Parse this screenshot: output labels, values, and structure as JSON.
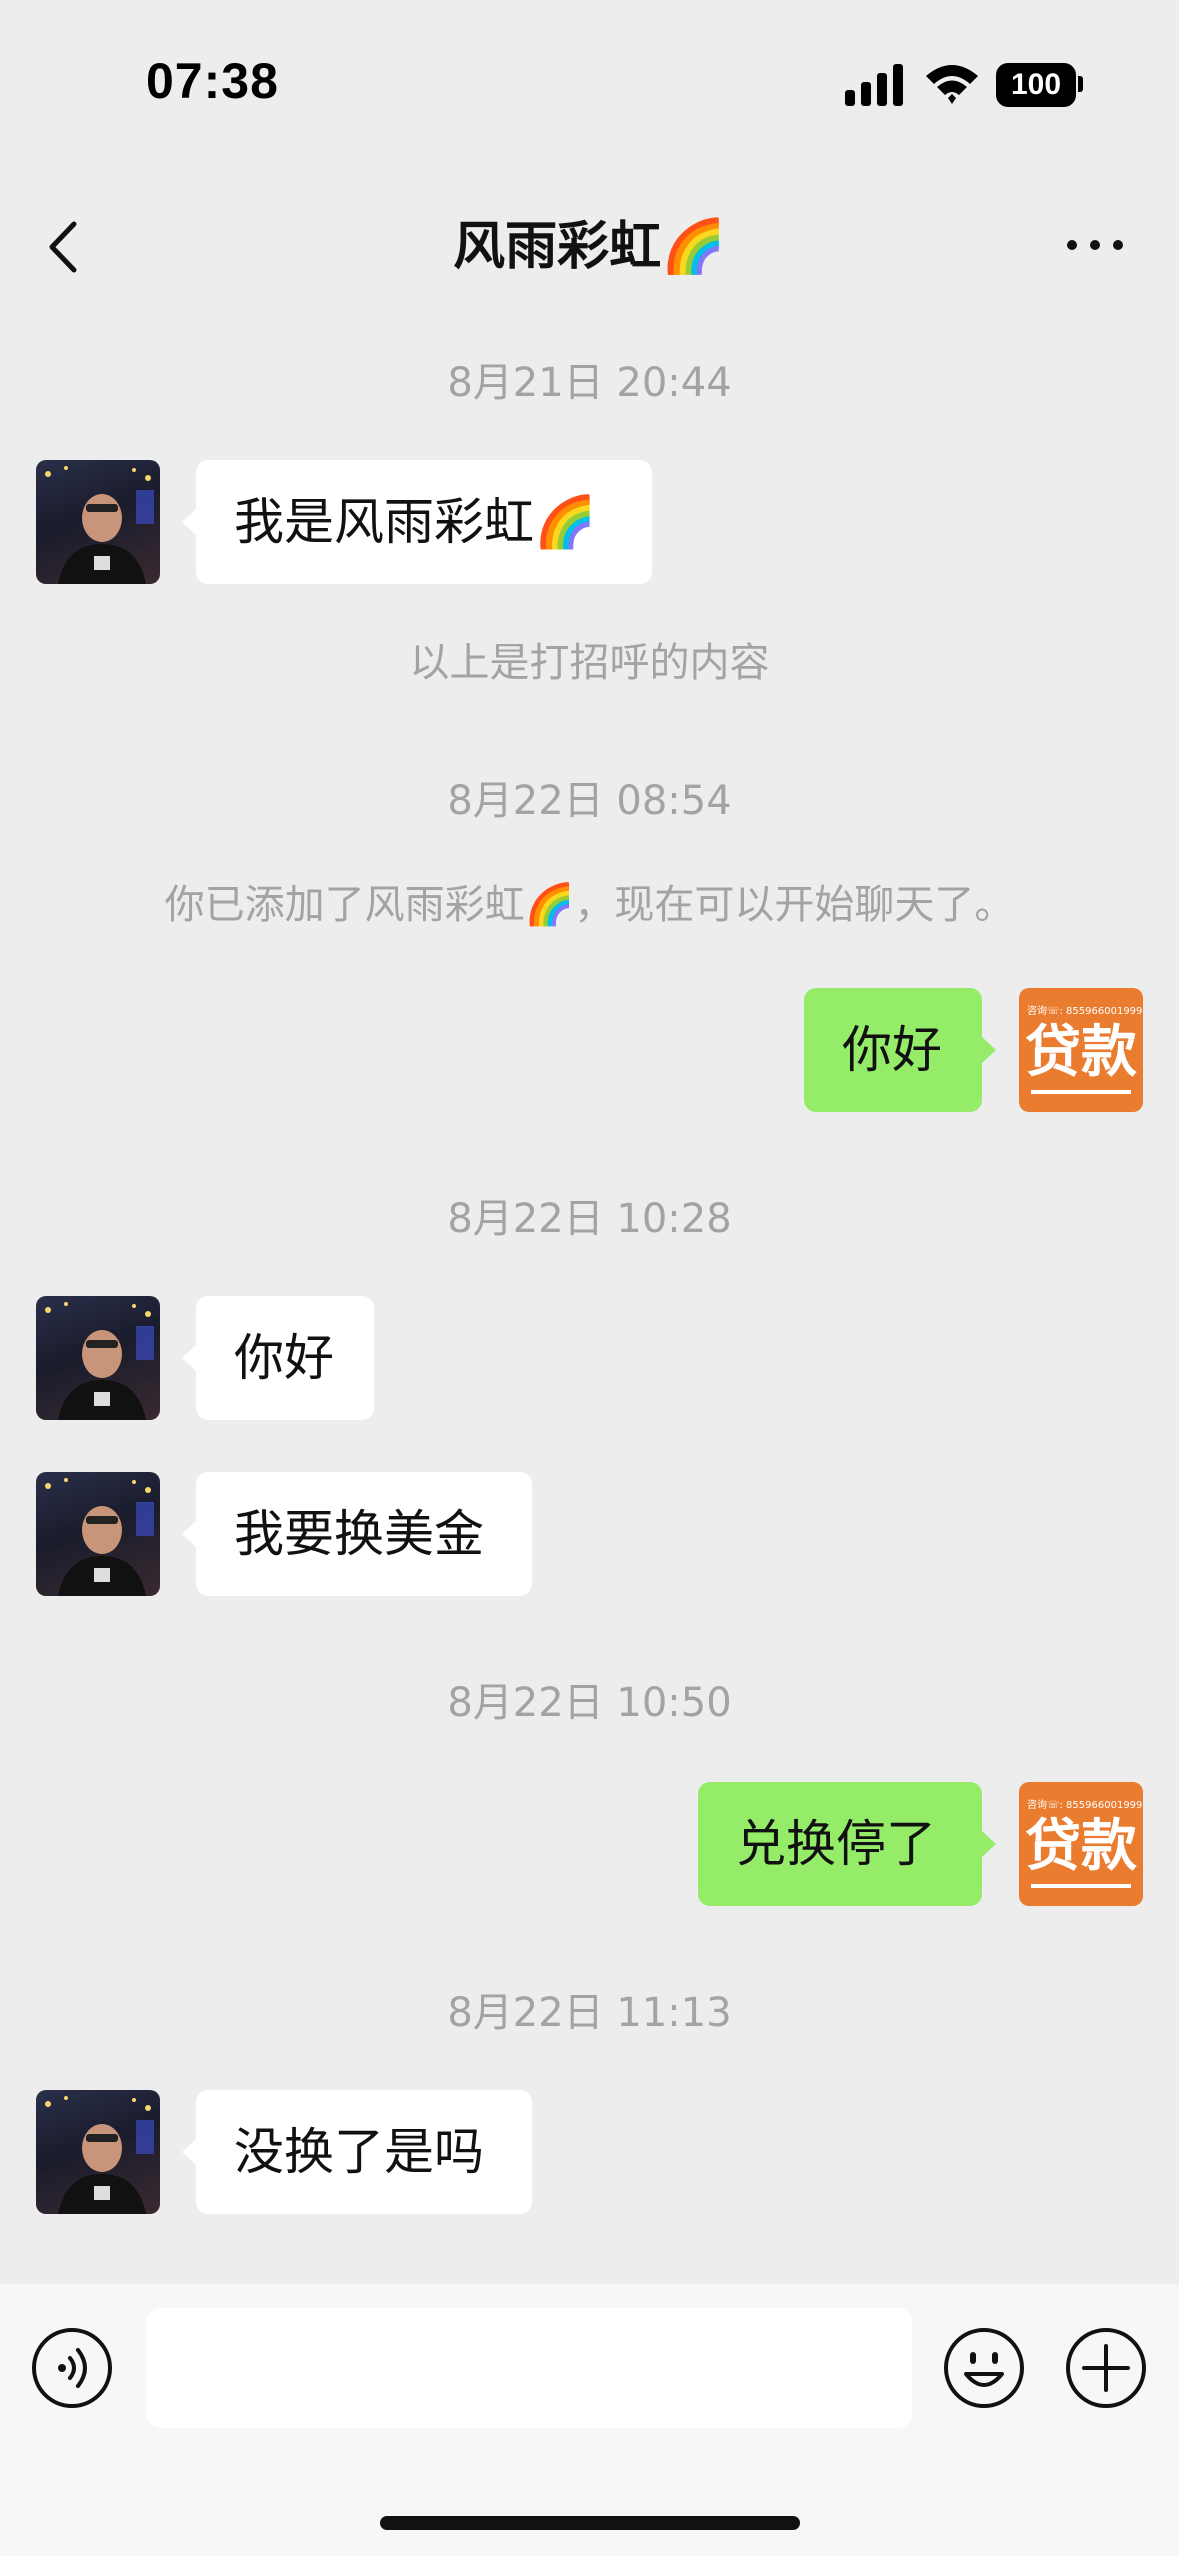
{
  "status_bar": {
    "time": "07:38",
    "battery": "100"
  },
  "header": {
    "title": "风雨彩虹🌈"
  },
  "messages": [
    {
      "type": "timestamp",
      "text": "8月21日 20:44"
    },
    {
      "type": "in",
      "text": "我是风雨彩虹🌈"
    },
    {
      "type": "note",
      "text": "以上是打招呼的内容"
    },
    {
      "type": "timestamp",
      "text": "8月22日 08:54"
    },
    {
      "type": "note",
      "text": "你已添加了风雨彩虹🌈，现在可以开始聊天了。"
    },
    {
      "type": "out",
      "text": "你好"
    },
    {
      "type": "timestamp",
      "text": "8月22日 10:28"
    },
    {
      "type": "in",
      "text": "你好"
    },
    {
      "type": "in",
      "text": "我要换美金"
    },
    {
      "type": "timestamp",
      "text": "8月22日 10:50"
    },
    {
      "type": "out",
      "text": "兑换停了"
    },
    {
      "type": "timestamp",
      "text": "8月22日 11:13"
    },
    {
      "type": "in",
      "text": "没换了是吗"
    }
  ],
  "self_avatar": {
    "top_text": "咨询☏: 855966001999",
    "big_text": "贷款"
  },
  "input": {
    "value": ""
  },
  "colors": {
    "background": "#ededed",
    "out_bubble": "#95ec69",
    "in_bubble": "#ffffff",
    "avatar_orange": "#ea7c30"
  },
  "icons": [
    "back-icon",
    "more-icon",
    "voice-icon",
    "emoji-icon",
    "plus-icon",
    "signal-icon",
    "wifi-icon",
    "battery-icon"
  ]
}
